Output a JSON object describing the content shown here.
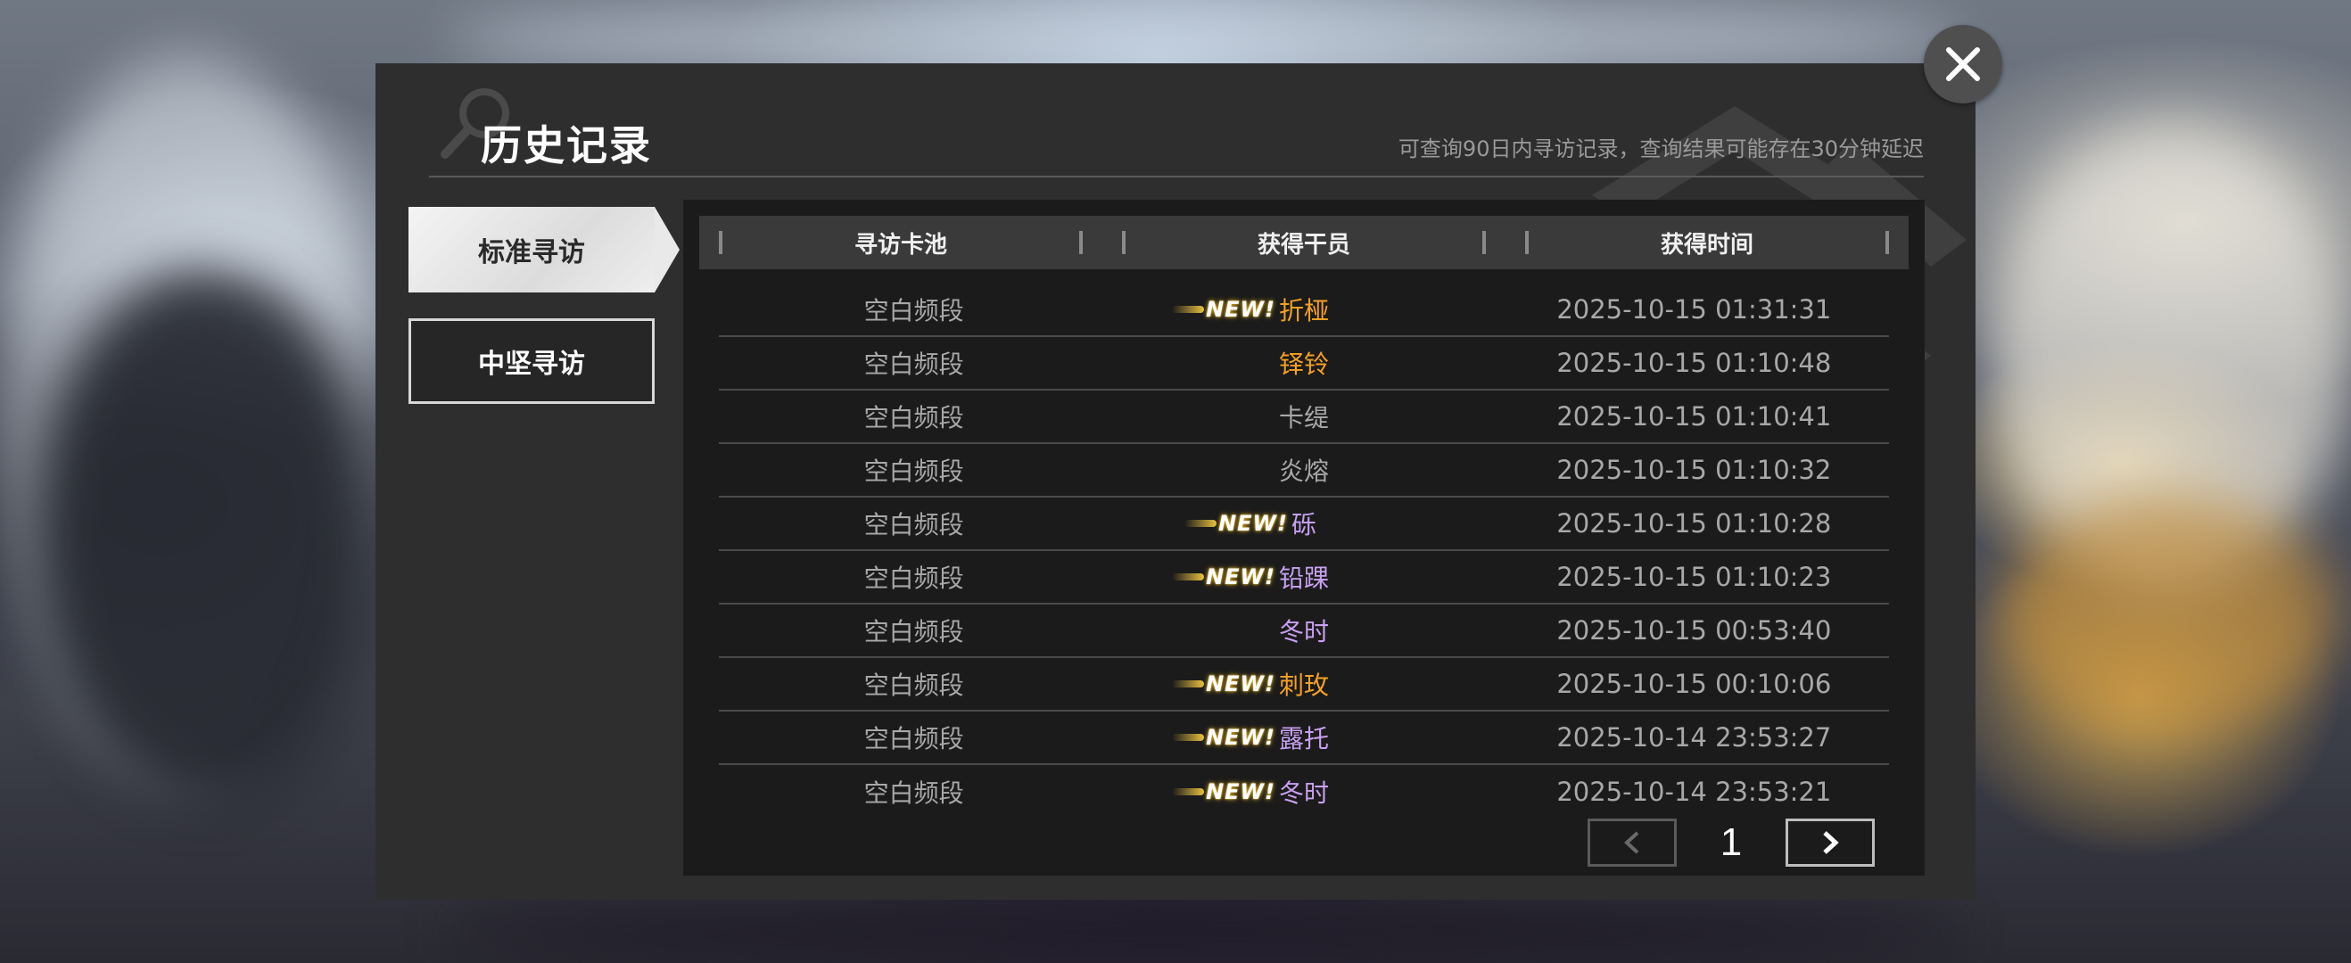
{
  "header": {
    "title": "历史记录",
    "subtitle": "可查询90日内寻访记录，查询结果可能存在30分钟延迟"
  },
  "tabs": [
    {
      "label": "标准寻访",
      "active": true
    },
    {
      "label": "中坚寻访",
      "active": false
    }
  ],
  "table": {
    "columns": [
      "寻访卡池",
      "获得干员",
      "获得时间"
    ],
    "rows": [
      {
        "pool": "空白频段",
        "new": true,
        "badge": "NEW!",
        "operator": "折桠",
        "color": "#f4a024",
        "time": "2025-10-15 01:31:31"
      },
      {
        "pool": "空白频段",
        "new": false,
        "badge": "",
        "operator": "铎铃",
        "color": "#f4a024",
        "time": "2025-10-15 01:10:48"
      },
      {
        "pool": "空白频段",
        "new": false,
        "badge": "",
        "operator": "卡缇",
        "color": "#a8a8a8",
        "time": "2025-10-15 01:10:41"
      },
      {
        "pool": "空白频段",
        "new": false,
        "badge": "",
        "operator": "炎熔",
        "color": "#a8a8a8",
        "time": "2025-10-15 01:10:32"
      },
      {
        "pool": "空白频段",
        "new": true,
        "badge": "NEW!",
        "operator": "砾",
        "color": "#c8a0f0",
        "time": "2025-10-15 01:10:28"
      },
      {
        "pool": "空白频段",
        "new": true,
        "badge": "NEW!",
        "operator": "铅踝",
        "color": "#c8a0f0",
        "time": "2025-10-15 01:10:23"
      },
      {
        "pool": "空白频段",
        "new": false,
        "badge": "",
        "operator": "冬时",
        "color": "#c8a0f0",
        "time": "2025-10-15 00:53:40"
      },
      {
        "pool": "空白频段",
        "new": true,
        "badge": "NEW!",
        "operator": "刺玫",
        "color": "#f4a024",
        "time": "2025-10-15 00:10:06"
      },
      {
        "pool": "空白频段",
        "new": true,
        "badge": "NEW!",
        "operator": "露托",
        "color": "#c8a0f0",
        "time": "2025-10-14 23:53:27"
      },
      {
        "pool": "空白频段",
        "new": true,
        "badge": "NEW!",
        "operator": "冬时",
        "color": "#c8a0f0",
        "time": "2025-10-14 23:53:21"
      }
    ]
  },
  "pager": {
    "page": "1",
    "prev_icon": "chevron-left-icon",
    "next_icon": "chevron-right-icon"
  },
  "close_icon": "close-icon"
}
